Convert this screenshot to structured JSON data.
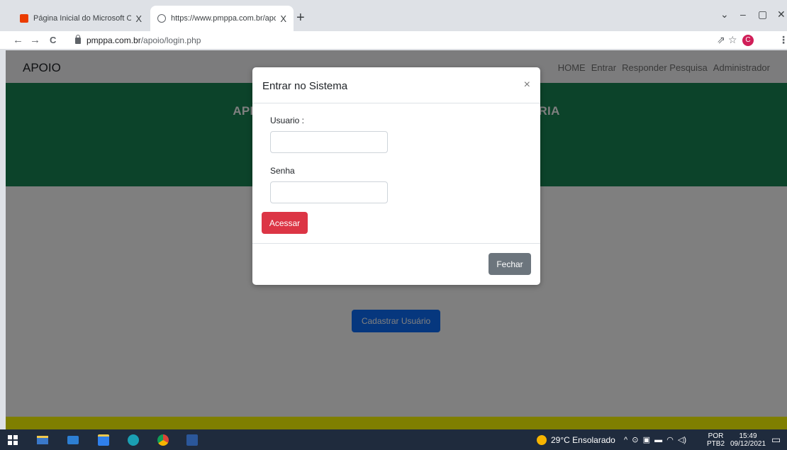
{
  "browser": {
    "tabs": [
      {
        "title": "Página Inicial do Microsoft Office",
        "close": "X",
        "active": false
      },
      {
        "title": "https://www.pmppa.com.br/apoi",
        "close": "X",
        "active": true
      }
    ],
    "new_tab": "+",
    "window_controls": [
      "⌄",
      "–",
      "▢",
      "✕"
    ],
    "nav": {
      "back": "←",
      "forward": "→",
      "reload": "C"
    },
    "address": {
      "host": "pmppa.com.br",
      "path": "/apoio/login.php"
    },
    "toolbar_icons": {
      "share": "⇗",
      "star": "☆",
      "menu": "⋮"
    },
    "profile_initial": "C"
  },
  "page": {
    "brand": "APOIO",
    "nav_links": [
      "HOME",
      "Entrar",
      "Responder Pesquisa",
      "Administrador"
    ],
    "hero_title": "APLICA                                                                    UÁRIA",
    "register_button": "Cadastrar Usuário",
    "colors": {
      "hero": "#198754",
      "footer": "#ffff00",
      "register": "#0d6efd"
    }
  },
  "modal": {
    "title": "Entrar no Sistema",
    "close": "×",
    "fields": [
      {
        "label": "Usuario :",
        "value": ""
      },
      {
        "label": "Senha",
        "value": ""
      }
    ],
    "submit_label": "Acessar",
    "close_label": "Fechar",
    "colors": {
      "submit": "#dc3545",
      "close": "#6c757d"
    }
  },
  "taskbar": {
    "weather": "29°C  Ensolarado",
    "tray_symbols": "^  ⊙  ▣  ▬  ◠  ◁)",
    "language": {
      "top": "POR",
      "bottom": "PTB2"
    },
    "clock": {
      "time": "15:49",
      "date": "09/12/2021"
    },
    "notifications_icon": "▭"
  }
}
